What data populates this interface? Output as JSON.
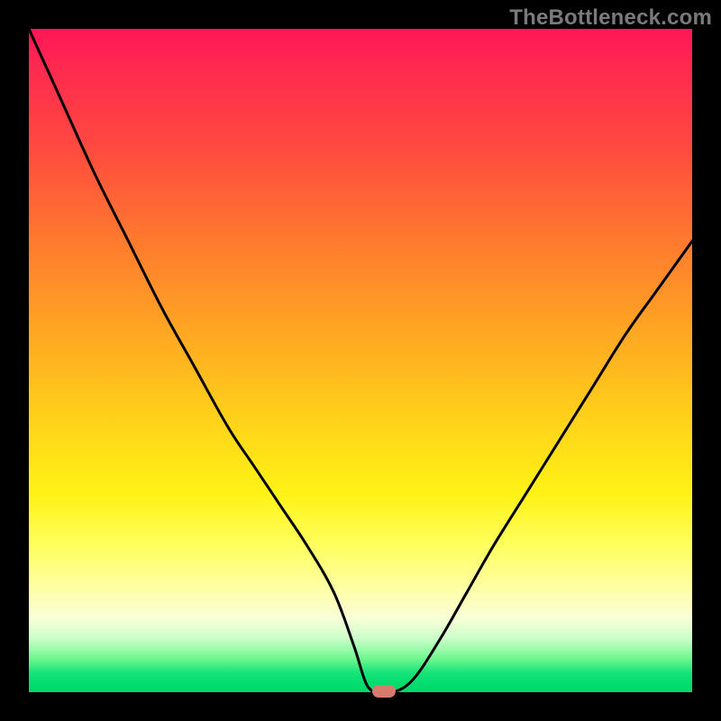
{
  "watermark": {
    "text": "TheBottleneck.com"
  },
  "chart_data": {
    "type": "line",
    "title": "",
    "xlabel": "",
    "ylabel": "",
    "xlim": [
      0,
      100
    ],
    "ylim": [
      0,
      100
    ],
    "grid": false,
    "legend": false,
    "background_gradient": {
      "top": "#ff1557",
      "upper_mid": "#ff7a2e",
      "mid": "#ffe015",
      "lower_mid": "#ffffa8",
      "bottom": "#00d968"
    },
    "series": [
      {
        "name": "bottleneck-curve",
        "color": "#000000",
        "x": [
          0,
          5,
          10,
          15,
          20,
          25,
          30,
          34,
          38,
          42,
          46,
          49,
          51,
          53,
          55,
          58,
          62,
          66,
          70,
          75,
          80,
          85,
          90,
          95,
          100
        ],
        "values": [
          100,
          89,
          78,
          68,
          58,
          49,
          40,
          34,
          28,
          22,
          15,
          7,
          1,
          0,
          0,
          2,
          8,
          15,
          22,
          30,
          38,
          46,
          54,
          61,
          68
        ]
      }
    ],
    "marker": {
      "name": "optimal-point",
      "x": 53.5,
      "y": 0,
      "color": "#d97a6e"
    }
  }
}
